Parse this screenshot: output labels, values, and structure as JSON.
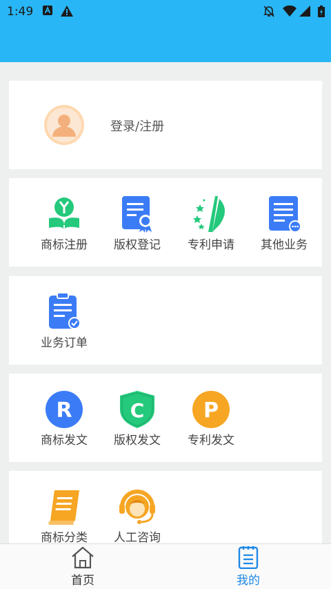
{
  "status_bar": {
    "time": "1:49",
    "icons": [
      "a-notification-icon",
      "warning-icon",
      "do-not-disturb-icon",
      "wifi-icon",
      "signal-icon",
      "battery-icon"
    ]
  },
  "profile": {
    "login_label": "登录/注册"
  },
  "services": [
    {
      "label": "商标注册",
      "icon": "trademark-registration-icon"
    },
    {
      "label": "版权登记",
      "icon": "copyright-registration-icon"
    },
    {
      "label": "专利申请",
      "icon": "patent-application-icon"
    },
    {
      "label": "其他业务",
      "icon": "other-business-icon"
    }
  ],
  "orders": [
    {
      "label": "业务订单",
      "icon": "business-order-icon"
    }
  ],
  "documents": [
    {
      "label": "商标发文",
      "icon": "trademark-doc-icon",
      "letter": "R",
      "color": "#3b7cf6"
    },
    {
      "label": "版权发文",
      "icon": "copyright-doc-icon",
      "letter": "C",
      "color": "#24c97c"
    },
    {
      "label": "专利发文",
      "icon": "patent-doc-icon",
      "letter": "P",
      "color": "#f6a623"
    }
  ],
  "tools": [
    {
      "label": "商标分类",
      "icon": "trademark-classification-icon"
    },
    {
      "label": "人工咨询",
      "icon": "customer-service-icon"
    }
  ],
  "tabs": [
    {
      "label": "首页",
      "icon": "home-icon",
      "active": false
    },
    {
      "label": "我的",
      "icon": "my-icon",
      "active": true
    }
  ],
  "colors": {
    "header": "#29b6f6",
    "accent": "#1e88e5",
    "blue": "#3b7cf6",
    "green": "#24c97c",
    "orange": "#f6a623"
  }
}
